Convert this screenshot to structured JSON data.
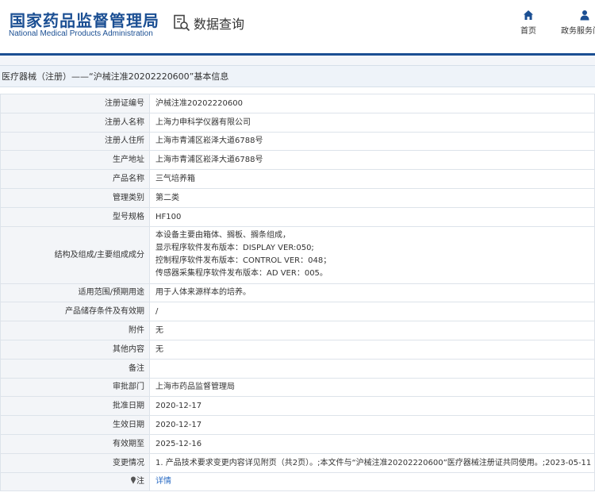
{
  "header": {
    "logo_cn": "国家药品监督管理局",
    "logo_en": "National Medical Products Administration",
    "search_label": "数据查询",
    "nav": [
      {
        "label": "首页",
        "icon": "home-icon"
      },
      {
        "label": "政务服务门户",
        "icon": "user-icon"
      }
    ]
  },
  "title": "医疗器械（注册）——“沪械注准20202220600”基本信息",
  "rows": [
    {
      "label": "注册证编号",
      "value": "沪械注准20202220600"
    },
    {
      "label": "注册人名称",
      "value": "上海力申科学仪器有限公司"
    },
    {
      "label": "注册人住所",
      "value": "上海市青浦区崧泽大道6788号"
    },
    {
      "label": "生产地址",
      "value": "上海市青浦区崧泽大道6788号"
    },
    {
      "label": "产品名称",
      "value": "三气培养箱"
    },
    {
      "label": "管理类别",
      "value": "第二类"
    },
    {
      "label": "型号规格",
      "value": "HF100"
    },
    {
      "label": "结构及组成/主要组成成分",
      "lines": [
        "本设备主要由箱体、搁板、搁条组成，",
        "显示程序软件发布版本：DISPLAY VER:050;",
        "控制程序软件发布版本：CONTROL VER：048；",
        "传感器采集程序软件发布版本：AD VER：005。"
      ]
    },
    {
      "label": "适用范围/预期用途",
      "value": "用于人体来源样本的培养。"
    },
    {
      "label": "产品储存条件及有效期",
      "value": "/"
    },
    {
      "label": "附件",
      "value": "无"
    },
    {
      "label": "其他内容",
      "value": "无"
    },
    {
      "label": "备注",
      "value": ""
    },
    {
      "label": "审批部门",
      "value": "上海市药品监督管理局"
    },
    {
      "label": "批准日期",
      "value": "2020-12-17"
    },
    {
      "label": "生效日期",
      "value": "2020-12-17"
    },
    {
      "label": "有效期至",
      "value": "2025-12-16"
    },
    {
      "label": "变更情况",
      "value": "1. 产品技术要求变更内容详见附页（共2页）。;本文件与“沪械注准20202220600”医疗器械注册证共同使用。;2023-05-11"
    },
    {
      "label": "注",
      "icon": "pin-icon",
      "value": "详情"
    }
  ]
}
